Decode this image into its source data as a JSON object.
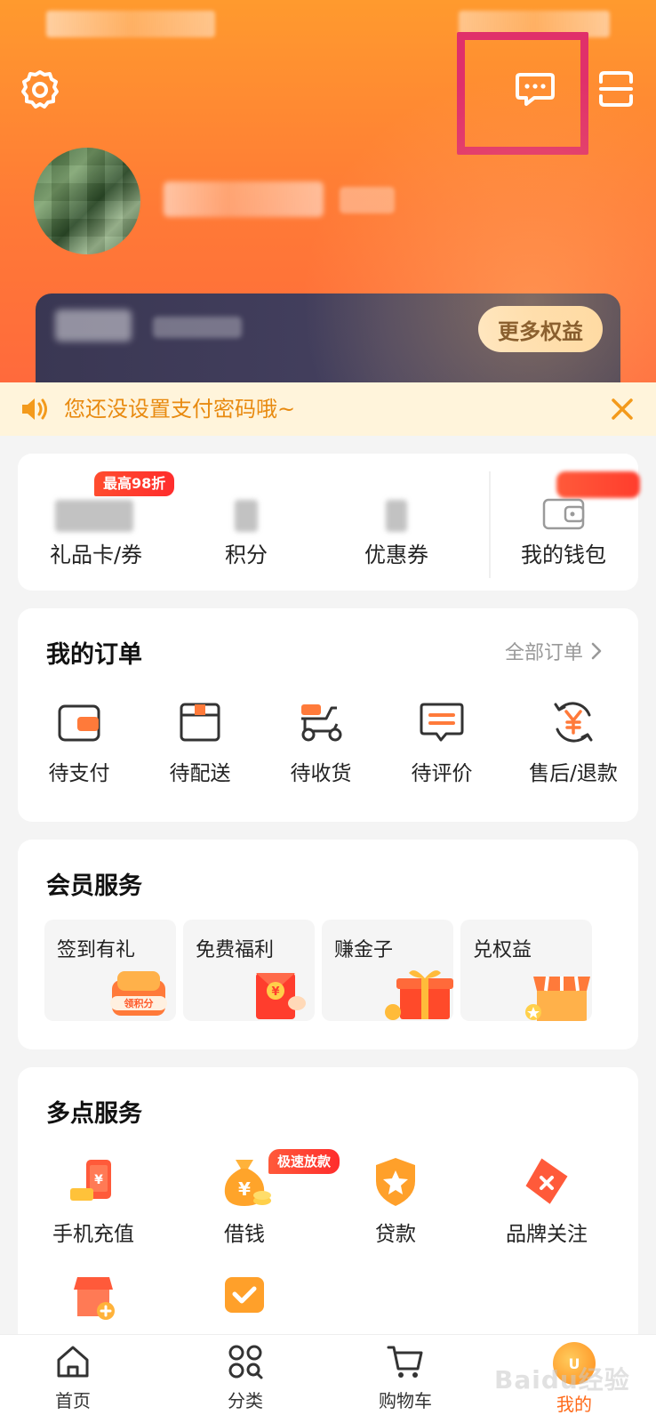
{
  "header": {
    "more_benefits_label": "更多权益"
  },
  "notice": {
    "text": "您还没设置支付密码哦~"
  },
  "assets": {
    "badge": "最高98折",
    "items": [
      {
        "label": "礼品卡/券"
      },
      {
        "label": "积分"
      },
      {
        "label": "优惠券"
      },
      {
        "label": "我的钱包"
      }
    ]
  },
  "orders": {
    "title": "我的订单",
    "all_link": "全部订单",
    "items": [
      {
        "label": "待支付",
        "icon": "wallet-pay-icon"
      },
      {
        "label": "待配送",
        "icon": "package-box-icon"
      },
      {
        "label": "待收货",
        "icon": "delivery-scooter-icon"
      },
      {
        "label": "待评价",
        "icon": "review-comment-icon"
      },
      {
        "label": "售后/退款",
        "icon": "refund-yen-icon"
      }
    ]
  },
  "member_services": {
    "title": "会员服务",
    "tiles": [
      {
        "label": "签到有礼",
        "art_text": "领积分"
      },
      {
        "label": "免费福利",
        "art_text": "¥"
      },
      {
        "label": "赚金子"
      },
      {
        "label": "兑权益"
      }
    ]
  },
  "duodian_services": {
    "title": "多点服务",
    "fast_badge": "极速放款",
    "items": [
      {
        "label": "手机充值",
        "icon": "phone-recharge-icon"
      },
      {
        "label": "借钱",
        "icon": "money-bag-icon"
      },
      {
        "label": "贷款",
        "icon": "shield-star-icon"
      },
      {
        "label": "品牌关注",
        "icon": "tag-brand-icon"
      }
    ]
  },
  "bottom_nav": {
    "items": [
      {
        "label": "首页",
        "icon": "home-icon"
      },
      {
        "label": "分类",
        "icon": "category-grid-icon"
      },
      {
        "label": "购物车",
        "icon": "cart-icon"
      },
      {
        "label": "我的",
        "icon": "mine-avatar-icon",
        "mine_text": "U"
      }
    ]
  },
  "watermark": "Baidu经验",
  "colors": {
    "accent": "#ff6a1a",
    "header_top": "#ff9a2e",
    "header_bottom": "#ff6a3c",
    "notice_text": "#e88a10",
    "highlight": "#e0306a"
  }
}
